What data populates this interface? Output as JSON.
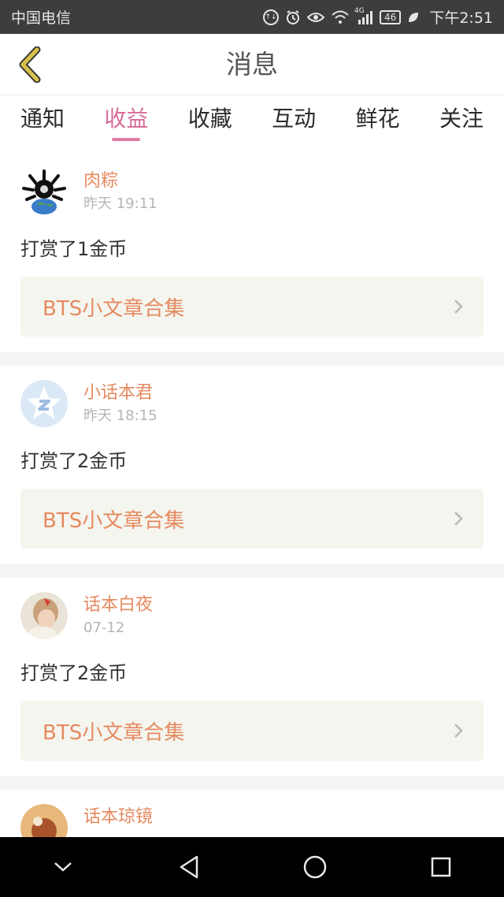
{
  "status_bar": {
    "carrier": "中国电信",
    "network": "4G",
    "battery": "46",
    "time": "下午2:51",
    "icons": [
      "data-saver-icon",
      "alarm-icon",
      "eye-icon",
      "wifi-icon",
      "signal-icon",
      "battery-icon",
      "leaf-icon"
    ]
  },
  "header": {
    "title": "消息",
    "back_icon": "chevron-left-icon",
    "back_color": "#d8c14a"
  },
  "tabs": [
    {
      "label": "通知",
      "active": false
    },
    {
      "label": "收益",
      "active": true
    },
    {
      "label": "收藏",
      "active": false
    },
    {
      "label": "互动",
      "active": false
    },
    {
      "label": "鲜花",
      "active": false
    },
    {
      "label": "关注",
      "active": false
    }
  ],
  "colors": {
    "accent_pink": "#d96b98",
    "name_orange": "#e58a5f",
    "card_bg": "#f5f5ef"
  },
  "messages": [
    {
      "user": "肉粽",
      "time": "昨天 19:11",
      "action": "打赏了1金币",
      "article": "BTS小文章合集",
      "avatar": "spiky-globe-avatar"
    },
    {
      "user": "小话本君",
      "time": "昨天 18:15",
      "action": "打赏了2金币",
      "article": "BTS小文章合集",
      "avatar": "default-star-avatar"
    },
    {
      "user": "话本白夜",
      "time": "07-12",
      "action": "打赏了2金币",
      "article": "BTS小文章合集",
      "avatar": "girl-photo-avatar"
    },
    {
      "user": "话本琼镜",
      "time": "",
      "action": "",
      "article": "",
      "avatar": "photo-avatar"
    }
  ],
  "nav_bar": {
    "buttons": [
      "collapse-icon",
      "back-triangle-icon",
      "home-circle-icon",
      "recents-square-icon"
    ]
  }
}
